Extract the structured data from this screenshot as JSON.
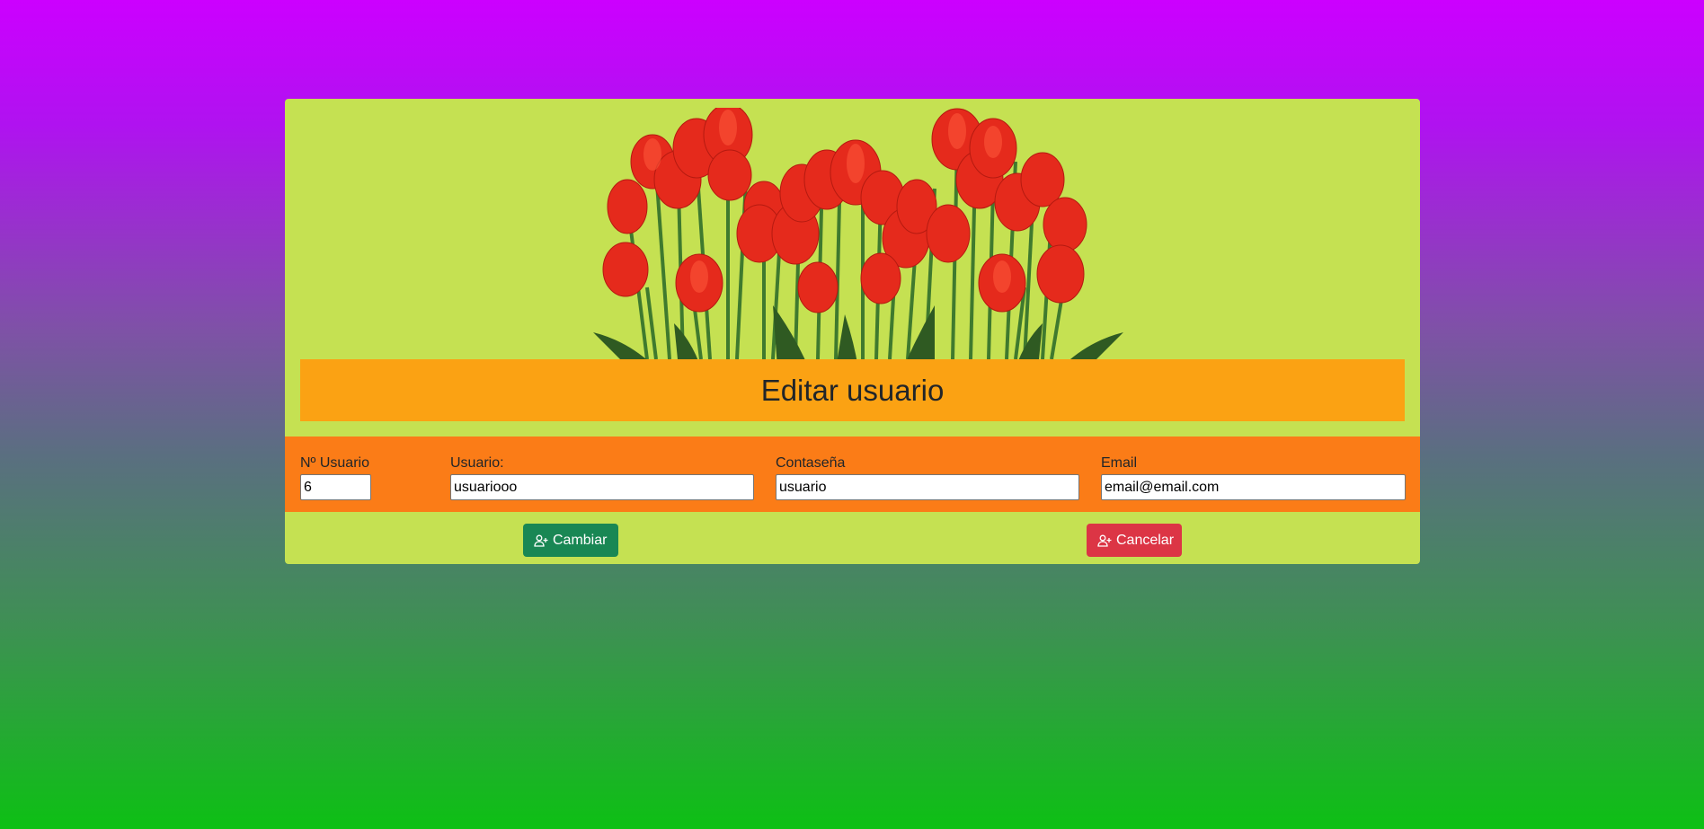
{
  "page": {
    "title": "Editar usuario",
    "image_alt": "tulips-image"
  },
  "form": {
    "id_label": "Nº Usuario",
    "id_value": "6",
    "user_label": "Usuario:",
    "user_value": "usuariooo",
    "password_label": "Contaseña",
    "password_value": "usuario",
    "email_label": "Email",
    "email_value": "email@email.com"
  },
  "actions": {
    "change_label": "Cambiar",
    "change_icon": "user-plus-icon",
    "cancel_label": "Cancelar",
    "cancel_icon": "user-plus-icon"
  },
  "colors": {
    "card_bg": "#c5e152",
    "title_bg": "#fba213",
    "form_bg": "#fb7c17",
    "change_button": "#198754",
    "cancel_button": "#dc3545"
  }
}
